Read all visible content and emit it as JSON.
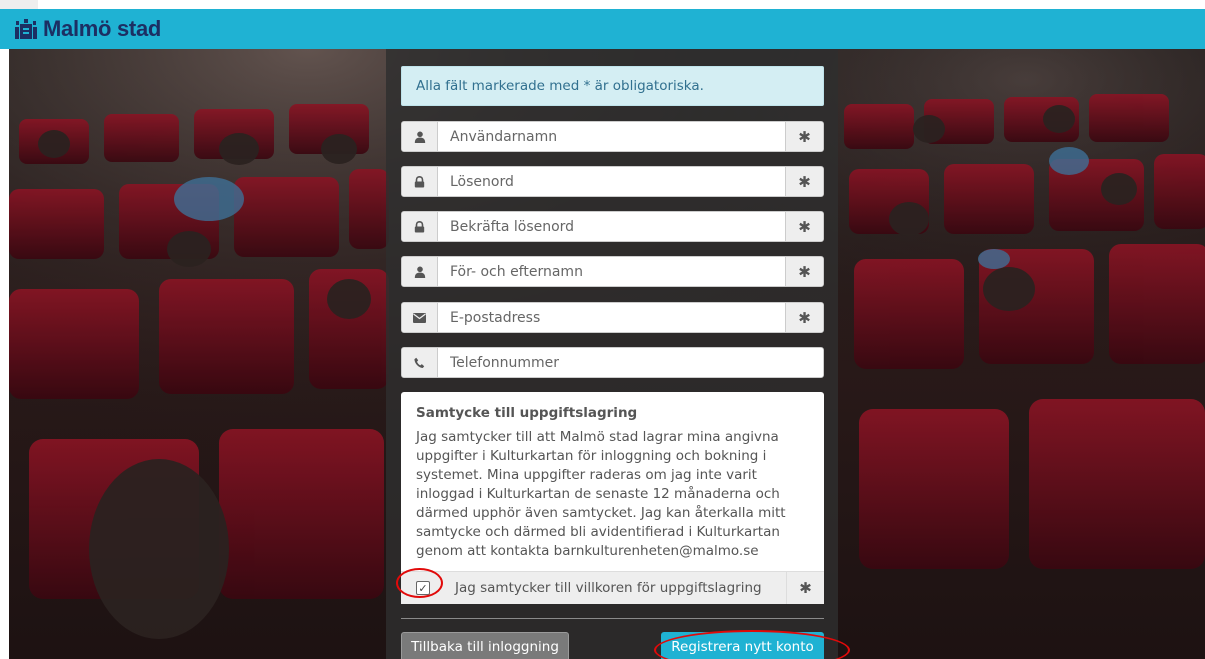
{
  "brand": {
    "name": "Malmö stad"
  },
  "colors": {
    "header": "#1fb2d3",
    "logo": "#1c2f63",
    "alert_bg": "#d4eef3",
    "alert_text": "#31708f",
    "annotation": "#e10a0a"
  },
  "alert": {
    "text": "Alla fält markerade med * är obligatoriska."
  },
  "form": {
    "fields": [
      {
        "name": "username",
        "icon": "user-icon",
        "placeholder": "Användarnamn",
        "required": true,
        "required_mark": "✱"
      },
      {
        "name": "password",
        "icon": "lock-icon",
        "placeholder": "Lösenord",
        "required": true,
        "required_mark": "✱"
      },
      {
        "name": "confirm-password",
        "icon": "lock-icon",
        "placeholder": "Bekräfta lösenord",
        "required": true,
        "required_mark": "✱"
      },
      {
        "name": "full-name",
        "icon": "user-icon",
        "placeholder": "För- och efternamn",
        "required": true,
        "required_mark": "✱"
      },
      {
        "name": "email",
        "icon": "envelope-icon",
        "placeholder": "E-postadress",
        "required": true,
        "required_mark": "✱"
      },
      {
        "name": "phone",
        "icon": "phone-icon",
        "placeholder": "Telefonnummer",
        "required": false
      }
    ]
  },
  "consent": {
    "title": "Samtycke till uppgiftslagring",
    "lines": [
      "Jag samtycker till att Malmö stad lagrar mina angivna",
      "uppgifter i Kulturkartan för inloggning och bokning i",
      "systemet. Mina uppgifter raderas om jag inte varit",
      "inloggad i Kulturkartan de senaste 12 månaderna och",
      "därmed upphör även samtycket. Jag kan återkalla mitt",
      "samtycke och därmed bli avidentifierad i Kulturkartan",
      "genom att kontakta barnkulturenheten@malmo.se"
    ],
    "checkbox_label": "Jag samtycker till villkoren för uppgiftslagring",
    "checkbox_checked": true,
    "checkbox_mark": "✓",
    "required_mark": "✱"
  },
  "buttons": {
    "back": "Tillbaka till inloggning",
    "register": "Registrera nytt konto"
  }
}
